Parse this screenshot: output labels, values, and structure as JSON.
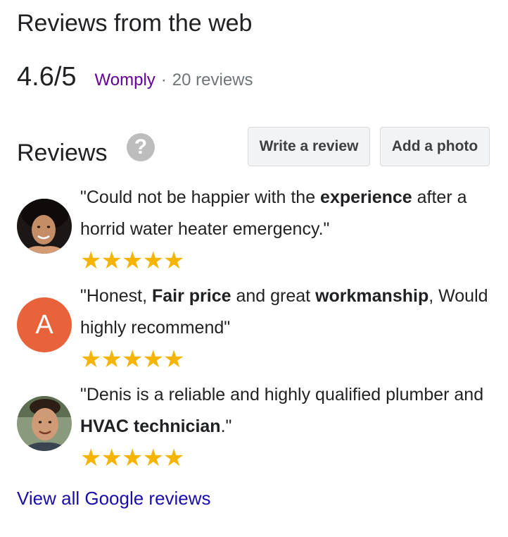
{
  "header": {
    "title": "Reviews from the web",
    "rating": "4.6/5",
    "source": "Womply",
    "separator": "·",
    "count": "20 reviews"
  },
  "reviews_section": {
    "heading": "Reviews",
    "help_glyph": "?",
    "write_review_label": "Write a review",
    "add_photo_label": "Add a photo"
  },
  "reviews": [
    {
      "avatar": "photo",
      "text_parts": [
        "\"Could not be happier with the ",
        "experience",
        " after a horrid water heater emergency.\""
      ],
      "stars": "★★★★★",
      "rating": 5
    },
    {
      "avatar": "A",
      "text_parts": [
        "\"Honest, ",
        "Fair price",
        " and great ",
        "workmanship",
        ", Would highly recommend\""
      ],
      "stars": "★★★★★",
      "rating": 5
    },
    {
      "avatar": "photo",
      "text_parts": [
        "\"Denis is a reliable and highly qualified plumber and ",
        "HVAC technician",
        ".\""
      ],
      "stars": "★★★★★",
      "rating": 5
    }
  ],
  "footer": {
    "view_all_label": "View all Google reviews"
  },
  "colors": {
    "source_link": "#660099",
    "view_all_link": "#1a0dab",
    "star": "#f4b400",
    "avatar_letter_bg": "#e8623a",
    "button_bg": "#f1f3f4"
  }
}
